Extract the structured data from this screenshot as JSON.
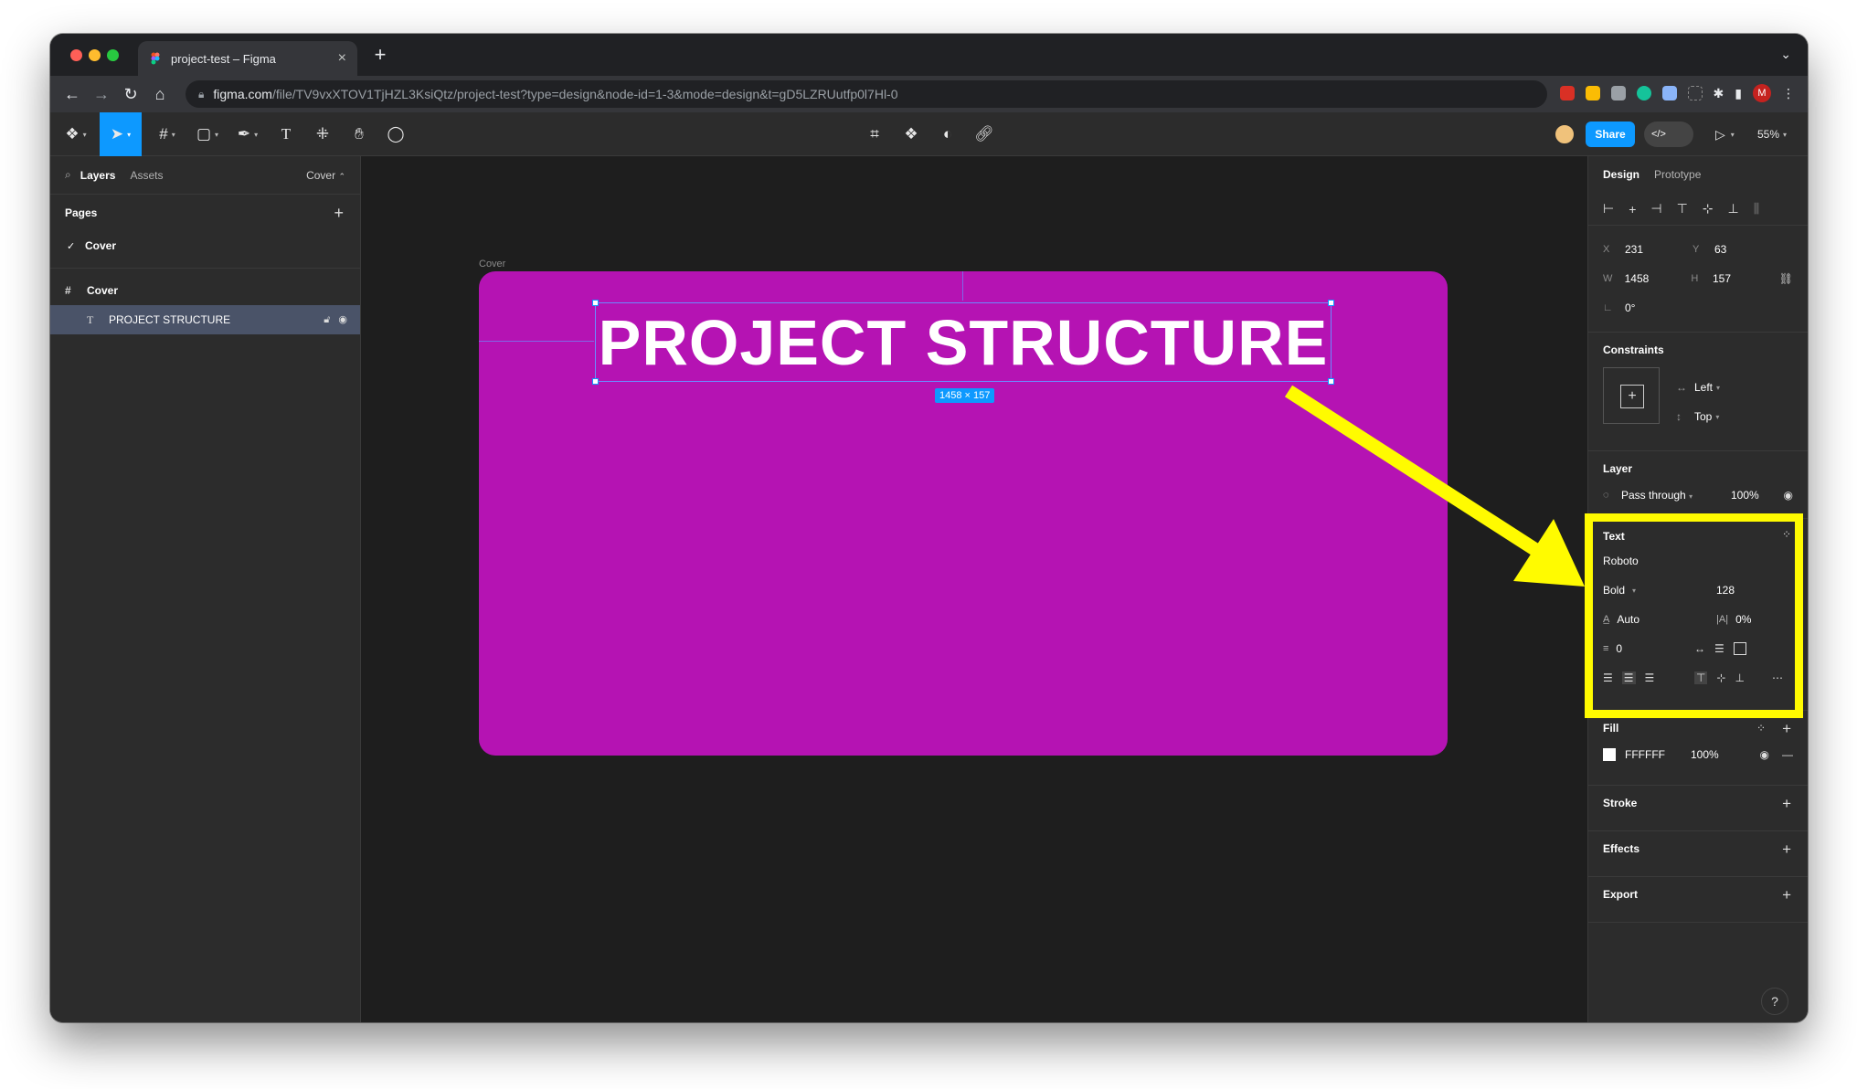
{
  "browser": {
    "tab_title": "project-test – Figma",
    "url_host": "figma.com",
    "url_path": "/file/TV9vxXTOV1TjHZL3KsiQtz/project-test?type=design&node-id=1-3&mode=design&t=gD5LZRUutfp0l7Hl-0",
    "profile_initial": "M"
  },
  "toolbar": {
    "share_label": "Share",
    "zoom": "55%",
    "devmode_label": "</>"
  },
  "left_panel": {
    "tabs": [
      "Layers",
      "Assets"
    ],
    "page_picker": "Cover",
    "pages_title": "Pages",
    "pages": [
      "Cover"
    ],
    "frame_name": "Cover",
    "layer_name": "PROJECT STRUCTURE"
  },
  "canvas": {
    "frame_label": "Cover",
    "frame_color": "#B513B3",
    "text": "PROJECT STRUCTURE",
    "size_badge": "1458 × 157"
  },
  "right_panel": {
    "tabs": [
      "Design",
      "Prototype"
    ],
    "x_label": "X",
    "x": "231",
    "y_label": "Y",
    "y": "63",
    "w_label": "W",
    "w": "1458",
    "h_label": "H",
    "h": "157",
    "rotation": "0°",
    "constraints_title": "Constraints",
    "constraint_h": "Left",
    "constraint_v": "Top",
    "layer_title": "Layer",
    "blend": "Pass through",
    "opacity": "100%",
    "text_title": "Text",
    "font": "Roboto",
    "weight": "Bold",
    "size": "128",
    "line_height": "Auto",
    "letter_spacing": "0%",
    "paragraph_spacing": "0",
    "fill_title": "Fill",
    "fill_hex": "FFFFFF",
    "fill_opacity": "100%",
    "stroke_title": "Stroke",
    "effects_title": "Effects",
    "export_title": "Export"
  },
  "annotation": {
    "highlight_color": "#FFFB00"
  }
}
